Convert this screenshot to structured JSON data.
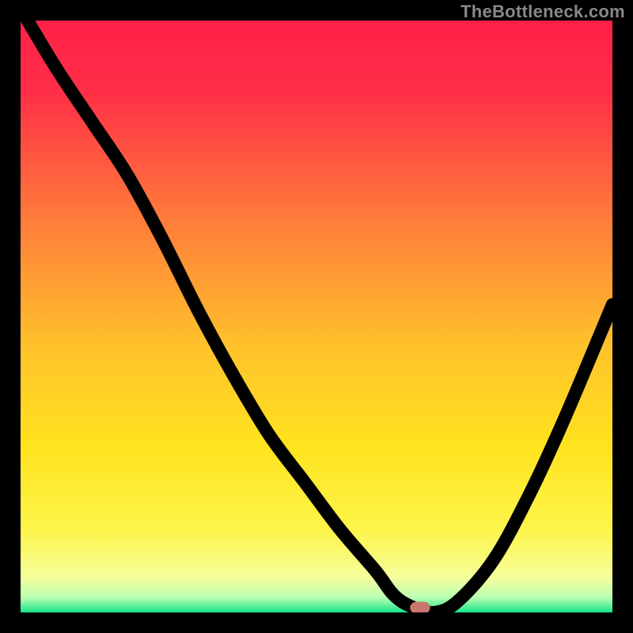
{
  "watermark": "TheBottleneck.com",
  "gradient_stops": [
    {
      "offset": "0%",
      "color": "#ff2048"
    },
    {
      "offset": "12%",
      "color": "#ff2f47"
    },
    {
      "offset": "34%",
      "color": "#ff7d3a"
    },
    {
      "offset": "55%",
      "color": "#ffc22b"
    },
    {
      "offset": "72%",
      "color": "#ffe31e"
    },
    {
      "offset": "86%",
      "color": "#fdf54a"
    },
    {
      "offset": "94%",
      "color": "#f6fe9a"
    },
    {
      "offset": "97.5%",
      "color": "#b9ffb2"
    },
    {
      "offset": "100%",
      "color": "#17e388"
    }
  ],
  "marker": {
    "x_pct": 67.5,
    "width_pct": 3.4,
    "height_pct": 2.0
  },
  "chart_data": {
    "type": "line",
    "title": "",
    "xlabel": "",
    "ylabel": "",
    "xlim": [
      0,
      100
    ],
    "ylim": [
      0,
      100
    ],
    "x": [
      0,
      6,
      12,
      18,
      24,
      30,
      36,
      42,
      48,
      54,
      60,
      63,
      66,
      70,
      74,
      80,
      86,
      92,
      100
    ],
    "values": [
      102,
      92,
      83,
      74,
      63,
      51,
      40,
      30,
      22,
      14,
      7,
      3,
      1,
      0,
      2,
      9,
      20,
      33,
      52
    ],
    "note": "y is bottleneck % (0 = perfect); minimum around x≈68"
  }
}
